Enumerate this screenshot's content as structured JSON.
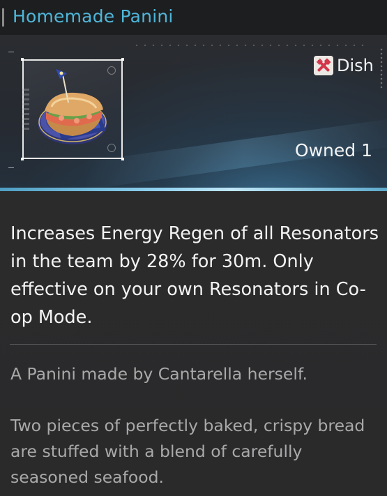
{
  "title": "Homemade Panini",
  "item": {
    "type_label": "Dish",
    "type_icon": "dish-crossed-utensils-icon",
    "owned_label": "Owned 1",
    "image": "panini-plate-icon"
  },
  "effect_text": "Increases Energy Regen of all Resonators in the team by 28% for 30m. Only effective on your own Resonators in Co-op Mode.",
  "lore": {
    "line1": "A Panini made by Cantarella herself.",
    "line2": "Two pieces of perfectly baked, crispy bread are stuffed with a blend of carefully seasoned seafood."
  },
  "colors": {
    "title": "#4fb6d8",
    "accent_glow": "#8fd0ee",
    "dish_icon_red": "#d2374b"
  }
}
